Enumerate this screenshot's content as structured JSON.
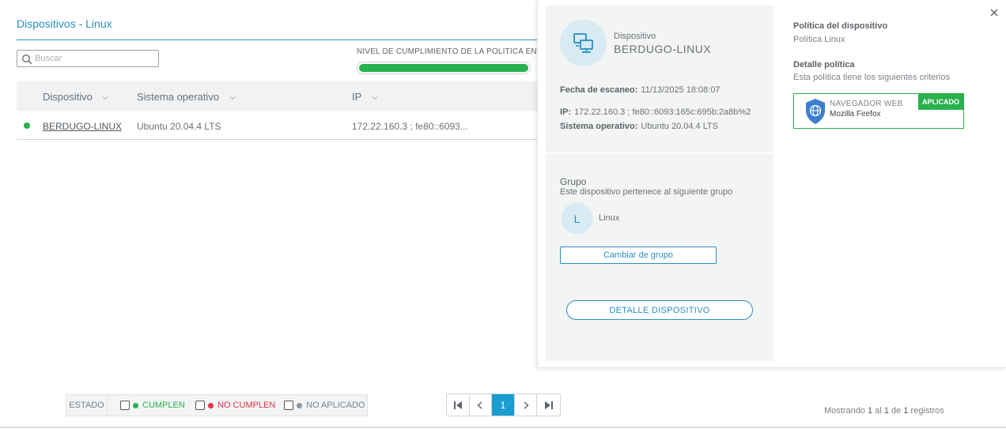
{
  "page": {
    "title": "Dispositivos - Linux"
  },
  "search": {
    "placeholder": "Buscar",
    "value": ""
  },
  "compliance": {
    "label": "NIVEL DE CUMPLIMIENTO DE LA POLÍTICA EN EL",
    "percent": 100,
    "color": "#28b14c"
  },
  "table": {
    "columns": [
      "Dispositivo",
      "Sistema operativo",
      "IP"
    ],
    "rows": [
      {
        "status": "cumple",
        "status_color": "#28b14c",
        "device": "BERDUGO-LINUX",
        "os": "Ubuntu 20.04.4 LTS",
        "ip": "172.22.160.3 ; fe80::6093..."
      }
    ]
  },
  "legend": {
    "estado_label": "ESTADO",
    "options": [
      {
        "label": "CUMPLEN",
        "color": "#28b14c",
        "checked": false
      },
      {
        "label": "NO CUMPLEN",
        "color": "#e0344a",
        "checked": false
      },
      {
        "label": "NO APLICADO",
        "color": "#8a96a3",
        "checked": false
      }
    ]
  },
  "pagination": {
    "current_page": "1"
  },
  "records": {
    "prefix": "Mostrando",
    "from": "1",
    "sep1": "al",
    "to": "1",
    "sep2": "de",
    "total": "1",
    "suffix": "registros"
  },
  "panel": {
    "device_kicker": "Dispositivo",
    "device_name": "BERDUGO-LINUX",
    "scan_label": "Fecha de escaneo:",
    "scan_value": "11/13/2025 18:08:07",
    "ip_label": "IP:",
    "ip_value": "172.22.160.3 ; fe80::6093:165c:695b:2a8b%2",
    "os_label": "Sistema operativo:",
    "os_value": "Ubuntu 20.04.4 LTS",
    "group_title": "Grupo",
    "group_subtitle": "Este dispositivo pertenece al siguiente grupo",
    "group_initial": "L",
    "group_name": "Linux",
    "change_group_label": "Cambiar de grupo",
    "detail_device_label": "DETALLE DISPOSITIVO",
    "policy_heading": "Política del dispositivo",
    "policy_name": "Política Linux",
    "policy_detail_heading": "Detalle política",
    "policy_detail_text": "Esta política tiene los siguientes criterios",
    "criterion_title": "NAVEGADOR WEB",
    "criterion_value": "Mozilla Firefox",
    "criterion_badge": "APLICADO"
  },
  "colors": {
    "accent": "#2a8fbf",
    "pager_active": "#1d9ccf",
    "success": "#28b14c"
  }
}
